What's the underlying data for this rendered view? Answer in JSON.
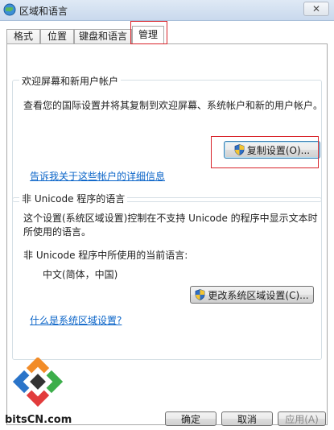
{
  "window": {
    "title": "区域和语言",
    "close_symbol": "✕"
  },
  "tabs": [
    {
      "label": "格式"
    },
    {
      "label": "位置"
    },
    {
      "label": "键盘和语言"
    },
    {
      "label": "管理"
    }
  ],
  "welcome_group": {
    "title": "欢迎屏幕和新用户帐户",
    "description": "查看您的国际设置并将其复制到欢迎屏幕、系统帐户和新的用户帐户。",
    "copy_button": "复制设置(O)...",
    "link": "告诉我关于这些帐户的详细信息"
  },
  "unicode_group": {
    "title": "非 Unicode 程序的语言",
    "description": "这个设置(系统区域设置)控制在不支持 Unicode 的程序中显示文本时所使用的语言。",
    "current_label": "非 Unicode 程序中所使用的当前语言:",
    "current_value": "中文(简体，中国)",
    "change_button": "更改系统区域设置(C)...",
    "link": "什么是系统区域设置?"
  },
  "footer": {
    "ok": "确定",
    "cancel": "取消",
    "apply": "应用(A)"
  },
  "watermark": {
    "text": "bitsCN.com"
  },
  "colors": {
    "highlight": "#d8232a",
    "link": "#0a64c8"
  }
}
